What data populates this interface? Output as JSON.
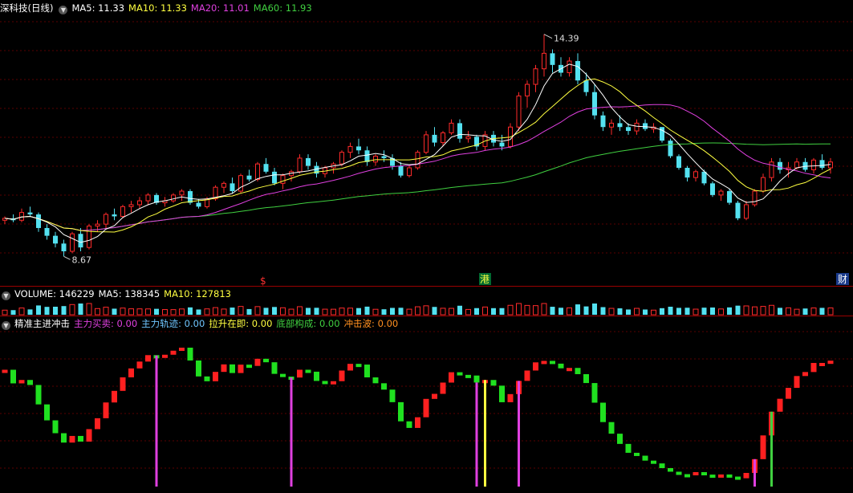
{
  "price_panel": {
    "stock_name": "深科技",
    "period": "(日线)",
    "ma5_label": "MA5: 11.33",
    "ma10_label": "MA10: 11.33",
    "ma20_label": "MA20: 11.01",
    "ma60_label": "MA60: 11.93",
    "high_marker": "14.39",
    "low_marker": "8.67",
    "markers": {
      "dollar": "$",
      "hk": "港",
      "fin": "财"
    }
  },
  "volume_panel": {
    "title": "VOLUME: 146229",
    "ma5_label": "MA5: 138345",
    "ma10_label": "MA10: 127813"
  },
  "indicator_panel": {
    "title": "精准主进冲击",
    "items": [
      {
        "label": "主力买卖: 0.00",
        "color": "#e040e0"
      },
      {
        "label": "主力轨迹: 0.00",
        "color": "#6fc6ff"
      },
      {
        "label": "拉升在即: 0.00",
        "color": "#ffff40"
      },
      {
        "label": "底部构成: 0.00",
        "color": "#40d040"
      },
      {
        "label": "冲击波: 0.00",
        "color": "#ff9020"
      }
    ]
  },
  "colors": {
    "up": "#ff2a2a",
    "down": "#54e1f0",
    "ma5": "#ffffff",
    "ma10": "#ffff40",
    "ma20": "#e040e0",
    "ma60": "#40d040",
    "grid": "#5a0000",
    "sep": "#9a0000"
  },
  "chart_data": {
    "type": "candlestick",
    "ohlc_series": [
      [
        9.6,
        9.7,
        9.5,
        9.65
      ],
      [
        9.65,
        9.75,
        9.55,
        9.6
      ],
      [
        9.6,
        9.9,
        9.55,
        9.8
      ],
      [
        9.8,
        9.95,
        9.7,
        9.75
      ],
      [
        9.75,
        9.8,
        9.3,
        9.4
      ],
      [
        9.4,
        9.5,
        9.1,
        9.2
      ],
      [
        9.2,
        9.3,
        8.9,
        9.0
      ],
      [
        9.0,
        9.1,
        8.67,
        8.8
      ],
      [
        8.8,
        9.3,
        8.75,
        9.25
      ],
      [
        9.25,
        9.4,
        8.8,
        8.9
      ],
      [
        8.9,
        9.5,
        8.85,
        9.45
      ],
      [
        9.45,
        9.6,
        9.3,
        9.5
      ],
      [
        9.5,
        9.8,
        9.4,
        9.75
      ],
      [
        9.75,
        9.9,
        9.6,
        9.7
      ],
      [
        9.7,
        10.0,
        9.65,
        9.95
      ],
      [
        9.95,
        10.1,
        9.8,
        10.0
      ],
      [
        10.0,
        10.2,
        9.9,
        10.1
      ],
      [
        10.1,
        10.3,
        10.0,
        10.25
      ],
      [
        10.25,
        10.3,
        10.0,
        10.05
      ],
      [
        10.05,
        10.2,
        9.95,
        10.1
      ],
      [
        10.1,
        10.3,
        10.05,
        10.25
      ],
      [
        10.25,
        10.4,
        10.1,
        10.35
      ],
      [
        10.35,
        10.4,
        10.0,
        10.05
      ],
      [
        10.05,
        10.15,
        9.9,
        9.95
      ],
      [
        9.95,
        10.2,
        9.9,
        10.15
      ],
      [
        10.15,
        10.5,
        10.1,
        10.45
      ],
      [
        10.45,
        10.6,
        10.3,
        10.55
      ],
      [
        10.55,
        10.7,
        10.3,
        10.35
      ],
      [
        10.35,
        10.8,
        10.3,
        10.75
      ],
      [
        10.75,
        10.9,
        10.6,
        10.65
      ],
      [
        10.65,
        11.1,
        10.6,
        11.05
      ],
      [
        11.05,
        11.2,
        10.8,
        10.85
      ],
      [
        10.85,
        10.95,
        10.5,
        10.55
      ],
      [
        10.55,
        10.8,
        10.4,
        10.75
      ],
      [
        10.75,
        10.9,
        10.6,
        10.85
      ],
      [
        10.85,
        11.3,
        10.8,
        11.2
      ],
      [
        11.2,
        11.3,
        10.9,
        11.0
      ],
      [
        11.0,
        11.1,
        10.7,
        10.8
      ],
      [
        10.8,
        11.0,
        10.7,
        10.95
      ],
      [
        10.95,
        11.1,
        10.8,
        11.05
      ],
      [
        11.05,
        11.4,
        11.0,
        11.35
      ],
      [
        11.35,
        11.6,
        11.2,
        11.5
      ],
      [
        11.5,
        11.7,
        11.3,
        11.4
      ],
      [
        11.4,
        11.5,
        11.0,
        11.1
      ],
      [
        11.1,
        11.3,
        11.0,
        11.25
      ],
      [
        11.25,
        11.4,
        11.1,
        11.2
      ],
      [
        11.2,
        11.3,
        10.9,
        11.0
      ],
      [
        11.0,
        11.1,
        10.7,
        10.75
      ],
      [
        10.75,
        11.0,
        10.7,
        10.95
      ],
      [
        10.95,
        11.4,
        10.9,
        11.35
      ],
      [
        11.35,
        11.9,
        11.3,
        11.8
      ],
      [
        11.8,
        12.0,
        11.5,
        11.6
      ],
      [
        11.6,
        11.9,
        11.5,
        11.85
      ],
      [
        11.85,
        12.2,
        11.8,
        12.1
      ],
      [
        12.1,
        12.2,
        11.6,
        11.7
      ],
      [
        11.7,
        11.9,
        11.6,
        11.75
      ],
      [
        11.75,
        11.8,
        11.4,
        11.5
      ],
      [
        11.5,
        11.9,
        11.4,
        11.8
      ],
      [
        11.8,
        11.9,
        11.5,
        11.6
      ],
      [
        11.6,
        11.8,
        11.4,
        11.5
      ],
      [
        11.5,
        12.1,
        11.45,
        12.0
      ],
      [
        12.0,
        12.9,
        11.9,
        12.8
      ],
      [
        12.8,
        13.2,
        12.5,
        13.1
      ],
      [
        13.1,
        13.6,
        12.9,
        13.5
      ],
      [
        13.5,
        14.39,
        13.3,
        13.9
      ],
      [
        13.9,
        14.0,
        13.4,
        13.6
      ],
      [
        13.6,
        13.8,
        13.3,
        13.4
      ],
      [
        13.4,
        13.8,
        13.3,
        13.7
      ],
      [
        13.7,
        13.9,
        13.1,
        13.2
      ],
      [
        13.2,
        13.4,
        12.8,
        12.9
      ],
      [
        12.9,
        13.1,
        12.2,
        12.3
      ],
      [
        12.3,
        12.4,
        11.9,
        12.0
      ],
      [
        12.0,
        12.2,
        11.8,
        12.1
      ],
      [
        12.1,
        12.3,
        11.9,
        12.0
      ],
      [
        12.0,
        12.1,
        11.8,
        11.9
      ],
      [
        11.9,
        12.2,
        11.8,
        12.1
      ],
      [
        12.1,
        12.2,
        11.9,
        11.95
      ],
      [
        11.95,
        12.1,
        11.85,
        12.0
      ],
      [
        12.0,
        12.0,
        11.6,
        11.65
      ],
      [
        11.65,
        11.7,
        11.2,
        11.25
      ],
      [
        11.25,
        11.3,
        10.9,
        10.95
      ],
      [
        10.95,
        11.0,
        10.6,
        10.7
      ],
      [
        10.7,
        10.9,
        10.6,
        10.85
      ],
      [
        10.85,
        10.9,
        10.5,
        10.55
      ],
      [
        10.55,
        10.6,
        10.2,
        10.25
      ],
      [
        10.25,
        10.4,
        10.1,
        10.35
      ],
      [
        10.35,
        10.4,
        10.0,
        10.05
      ],
      [
        10.05,
        10.1,
        9.6,
        9.65
      ],
      [
        9.65,
        10.1,
        9.6,
        10.0
      ],
      [
        10.0,
        10.4,
        9.95,
        10.35
      ],
      [
        10.35,
        10.8,
        10.3,
        10.7
      ],
      [
        10.7,
        11.2,
        10.6,
        11.1
      ],
      [
        11.1,
        11.2,
        10.8,
        10.9
      ],
      [
        10.9,
        11.1,
        10.7,
        10.95
      ],
      [
        10.95,
        11.2,
        10.9,
        11.1
      ],
      [
        11.1,
        11.2,
        10.85,
        10.9
      ],
      [
        10.9,
        11.2,
        10.8,
        11.15
      ],
      [
        11.15,
        11.3,
        10.9,
        10.95
      ],
      [
        10.95,
        11.2,
        10.8,
        11.1
      ]
    ]
  }
}
